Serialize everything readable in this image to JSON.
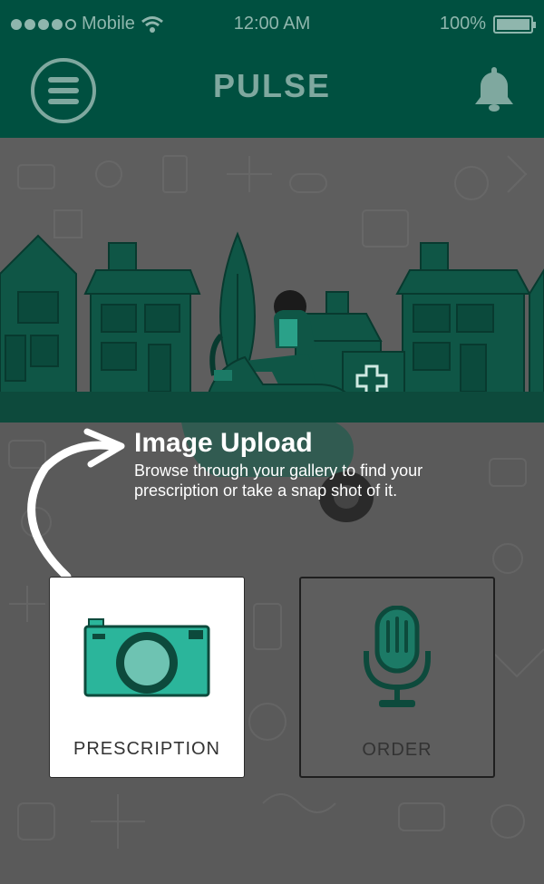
{
  "status_bar": {
    "carrier": "Mobile",
    "time": "12:00 AM",
    "battery": "100%",
    "signal_bars_filled": 4,
    "signal_bars_total": 5
  },
  "header": {
    "title": "PULSE"
  },
  "tip": {
    "title": "Image Upload",
    "description": "Browse through your gallery to find your prescription or take a snap shot of it."
  },
  "cards": {
    "prescription": {
      "label": "PRESCRIPTION",
      "icon": "camera-icon"
    },
    "order": {
      "label": "ORDER",
      "icon": "microphone-icon"
    }
  },
  "colors": {
    "header_bg": "#005040",
    "accent": "#2bb59b",
    "overlay": "#5a5a5a",
    "dark_green": "#0d4a3c"
  }
}
